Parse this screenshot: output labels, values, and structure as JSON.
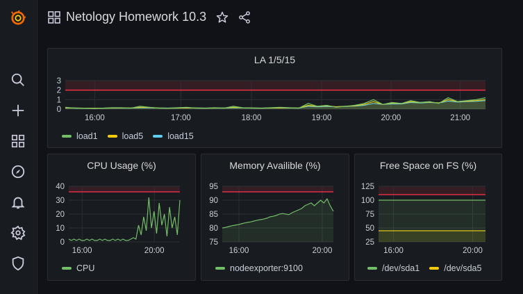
{
  "dashboard": {
    "title": "Netology Homework 10.3"
  },
  "sidebar": {
    "items": [
      "grafana-logo",
      "search",
      "create",
      "dashboards",
      "explore",
      "alerting",
      "configuration",
      "shield"
    ]
  },
  "colors": {
    "green": "#73bf69",
    "yellow": "#f2cc0c",
    "blue": "#5794f2",
    "cyan": "#8ab8ff",
    "threshold": "#e02f44",
    "brand": "#f46800"
  },
  "panels": {
    "la": {
      "title": "LA 1/5/15",
      "legend": [
        {
          "label": "load1",
          "color": "#73bf69"
        },
        {
          "label": "load5",
          "color": "#f2cc0c"
        },
        {
          "label": "load15",
          "color": "#5fd0ef"
        }
      ]
    },
    "cpu": {
      "title": "CPU Usage (%)",
      "legend": [
        {
          "label": "CPU",
          "color": "#73bf69"
        }
      ]
    },
    "mem": {
      "title": "Memory Availible (%)",
      "legend": [
        {
          "label": "nodeexporter:9100",
          "color": "#73bf69"
        }
      ]
    },
    "fs": {
      "title": "Free Space on FS (%)",
      "legend": [
        {
          "label": "/dev/sda1",
          "color": "#73bf69"
        },
        {
          "label": "/dev/sda5",
          "color": "#f2cc0c"
        }
      ]
    }
  },
  "chart_data": [
    {
      "type": "line",
      "title": "LA 1/5/15",
      "x_ticks": [
        "16:00",
        "17:00",
        "18:00",
        "19:00",
        "20:00",
        "21:00"
      ],
      "y_ticks": [
        0,
        1,
        2,
        3
      ],
      "ylim": [
        0,
        3
      ],
      "threshold": 2,
      "series": [
        {
          "name": "load1",
          "values": [
            0.2,
            0.1,
            0.1,
            0.05,
            0.1,
            0.15,
            0.15,
            0.1,
            0.3,
            0.2,
            0.1,
            0.1,
            0.15,
            0.2,
            0.1,
            0.1,
            0.15,
            0.1,
            0.3,
            0.15,
            0.1,
            0.1,
            0.15,
            0.2,
            0.15,
            0.1,
            0.6,
            0.3,
            0.4,
            0.2,
            0.3,
            0.4,
            0.6,
            1.0,
            0.5,
            0.7,
            0.6,
            0.9,
            0.7,
            0.8,
            0.6,
            1.2,
            0.8,
            0.9,
            1.0,
            1.2
          ]
        },
        {
          "name": "load5",
          "values": [
            0.15,
            0.12,
            0.1,
            0.08,
            0.1,
            0.12,
            0.13,
            0.12,
            0.2,
            0.18,
            0.12,
            0.1,
            0.12,
            0.15,
            0.12,
            0.1,
            0.12,
            0.12,
            0.2,
            0.15,
            0.12,
            0.1,
            0.12,
            0.15,
            0.14,
            0.12,
            0.4,
            0.3,
            0.35,
            0.25,
            0.3,
            0.35,
            0.5,
            0.8,
            0.5,
            0.65,
            0.6,
            0.8,
            0.7,
            0.75,
            0.65,
            1.0,
            0.8,
            0.85,
            0.9,
            1.0
          ]
        },
        {
          "name": "load15",
          "values": [
            0.12,
            0.11,
            0.1,
            0.09,
            0.1,
            0.11,
            0.11,
            0.11,
            0.15,
            0.14,
            0.12,
            0.11,
            0.11,
            0.13,
            0.12,
            0.11,
            0.11,
            0.11,
            0.15,
            0.13,
            0.12,
            0.11,
            0.11,
            0.13,
            0.12,
            0.11,
            0.3,
            0.25,
            0.28,
            0.25,
            0.28,
            0.32,
            0.4,
            0.6,
            0.5,
            0.55,
            0.55,
            0.7,
            0.65,
            0.7,
            0.65,
            0.85,
            0.75,
            0.8,
            0.82,
            0.9
          ]
        }
      ]
    },
    {
      "type": "line",
      "title": "CPU Usage (%)",
      "x_ticks": [
        "16:00",
        "20:00"
      ],
      "y_ticks": [
        0,
        10,
        20,
        30,
        40
      ],
      "ylim": [
        0,
        40
      ],
      "threshold": 36,
      "series": [
        {
          "name": "CPU",
          "values": [
            2,
            1,
            2,
            1,
            2,
            1,
            1,
            2,
            1,
            2,
            1,
            1,
            2,
            1,
            2,
            1,
            1,
            2,
            1,
            2,
            1,
            2,
            1,
            1,
            2,
            3,
            2,
            12,
            5,
            18,
            8,
            32,
            10,
            22,
            6,
            28,
            12,
            20,
            4,
            25,
            10,
            18,
            5,
            30
          ]
        }
      ]
    },
    {
      "type": "line",
      "title": "Memory Availible (%)",
      "x_ticks": [
        "16:00",
        "20:00"
      ],
      "y_ticks": [
        75,
        80,
        85,
        90,
        95
      ],
      "ylim": [
        75,
        95
      ],
      "threshold": 93,
      "series": [
        {
          "name": "nodeexporter:9100",
          "values": [
            80,
            80.2,
            80.5,
            80.8,
            81,
            81.2,
            81.5,
            81.8,
            82,
            82.2,
            82.5,
            82.8,
            83,
            83.2,
            83.5,
            84,
            84.2,
            84.5,
            85,
            85.2,
            85,
            84.8,
            85.5,
            86,
            86.5,
            87,
            88,
            88.5,
            89,
            88,
            89,
            90,
            89,
            90.5,
            88,
            86
          ]
        }
      ]
    },
    {
      "type": "line",
      "title": "Free Space on FS (%)",
      "x_ticks": [
        "16:00",
        "20:00"
      ],
      "y_ticks": [
        25,
        50,
        75,
        100,
        125
      ],
      "ylim": [
        25,
        125
      ],
      "threshold": 110,
      "series": [
        {
          "name": "/dev/sda1",
          "values": [
            100,
            100,
            100,
            100,
            100,
            100,
            100,
            100,
            100,
            100
          ]
        },
        {
          "name": "/dev/sda5",
          "values": [
            45,
            45,
            45,
            45,
            45,
            45,
            45,
            45,
            45,
            45
          ]
        }
      ]
    }
  ]
}
